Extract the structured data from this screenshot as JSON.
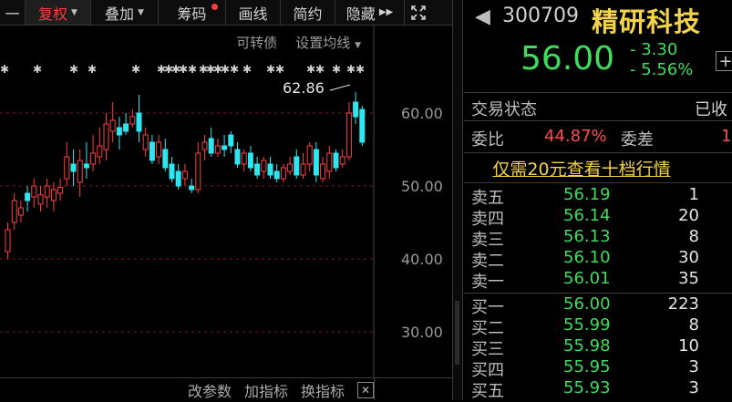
{
  "toolbar": {
    "dash_label": "一",
    "fq_label": "复权",
    "overlay_label": "叠加",
    "chip_label": "筹码",
    "line_label": "画线",
    "simple_label": "简约",
    "hide_label": "隐藏"
  },
  "chart": {
    "links": [
      "可转债",
      "设置均线"
    ],
    "price_labels": [
      "60.00",
      "50.00",
      "40.00",
      "30.00"
    ],
    "high_marker": "62.86",
    "colors": {
      "up": "#ff4040",
      "down": "#2ee6f0",
      "grid": "#7a1a1a"
    }
  },
  "bottom": {
    "labels": [
      "改参数",
      "加指标",
      "换指标"
    ]
  },
  "quote": {
    "code": "300709",
    "name": "精研科技",
    "price": "56.00",
    "change": "- 3.30",
    "change_pct": "- 5.56%",
    "state_label": "交易状态",
    "state_value": "已收",
    "ratio_label": "委比",
    "ratio_value": "44.87%",
    "diff_label": "委差",
    "diff_value": "1",
    "promo": "仅需20元查看十档行情"
  },
  "order_book": {
    "asks": [
      {
        "label": "卖五",
        "price": "56.19",
        "vol": "1"
      },
      {
        "label": "卖四",
        "price": "56.14",
        "vol": "20"
      },
      {
        "label": "卖三",
        "price": "56.13",
        "vol": "8"
      },
      {
        "label": "卖二",
        "price": "56.10",
        "vol": "30"
      },
      {
        "label": "卖一",
        "price": "56.01",
        "vol": "35"
      }
    ],
    "bids": [
      {
        "label": "买一",
        "price": "56.00",
        "vol": "223"
      },
      {
        "label": "买二",
        "price": "55.99",
        "vol": "8"
      },
      {
        "label": "买三",
        "price": "55.98",
        "vol": "10"
      },
      {
        "label": "买四",
        "price": "55.95",
        "vol": "3"
      },
      {
        "label": "买五",
        "price": "55.93",
        "vol": "3"
      }
    ]
  }
}
